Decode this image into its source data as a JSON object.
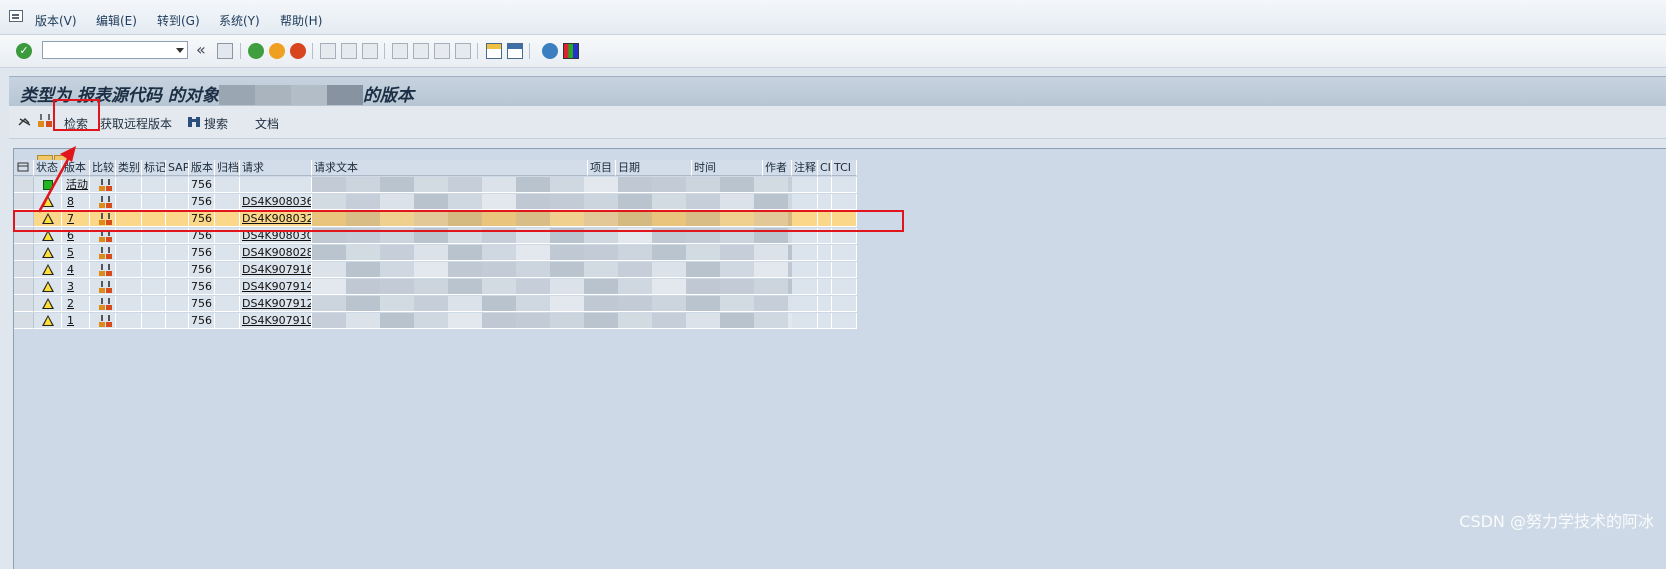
{
  "menu": {
    "items": [
      "版本(V)",
      "编辑(E)",
      "转到(G)",
      "系统(Y)",
      "帮助(H)"
    ]
  },
  "toolbar": {
    "command_field_value": "",
    "back_glyph": "«"
  },
  "title": {
    "prefix": "类型为 报表源代码 的对象",
    "suffix": "的版本"
  },
  "app_toolbar": {
    "search_label": "检索",
    "remote_label": "获取远程版本",
    "find_label": "搜索",
    "docs_label": "文档"
  },
  "grid": {
    "columns": [
      "状态",
      "版本",
      "比较",
      "类别",
      "标记",
      "SAP",
      "版本",
      "归档",
      "请求",
      "请求文本",
      "项目",
      "日期",
      "时间",
      "作者",
      "注释",
      "CI",
      "TCI"
    ],
    "rows": [
      {
        "status": "active",
        "version": "活动",
        "release": "756",
        "request": ""
      },
      {
        "status": "warning",
        "version": "8",
        "release": "756",
        "request": "DS4K908036"
      },
      {
        "status": "warning",
        "version": "7",
        "release": "756",
        "request": "DS4K908032"
      },
      {
        "status": "warning",
        "version": "6",
        "release": "756",
        "request": "DS4K908030"
      },
      {
        "status": "warning",
        "version": "5",
        "release": "756",
        "request": "DS4K908028"
      },
      {
        "status": "warning",
        "version": "4",
        "release": "756",
        "request": "DS4K907916"
      },
      {
        "status": "warning",
        "version": "3",
        "release": "756",
        "request": "DS4K907914"
      },
      {
        "status": "warning",
        "version": "2",
        "release": "756",
        "request": "DS4K907912"
      },
      {
        "status": "warning",
        "version": "1",
        "release": "756",
        "request": "DS4K907910"
      }
    ]
  },
  "watermark": "CSDN @努力学技术的阿冰",
  "colors": {
    "highlight_row": "#fbd78a",
    "annotation_red": "#e0161c",
    "warning_yellow": "#ffe03a",
    "active_green": "#22b522"
  }
}
